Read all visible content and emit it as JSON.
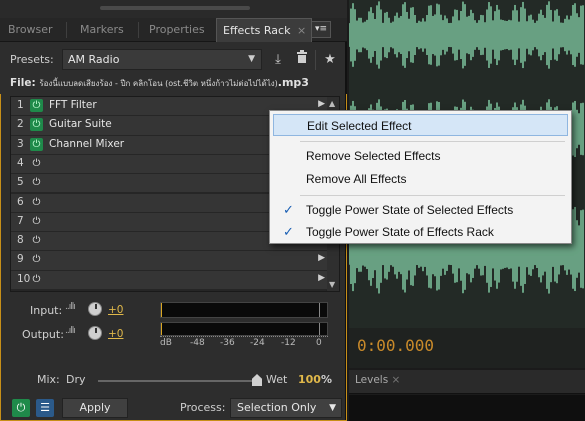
{
  "tabs": [
    "Browser",
    "Markers",
    "Properties",
    "Effects Rack"
  ],
  "tab_close": "×",
  "panel_menu_icon": "▾≡",
  "presets": {
    "label": "Presets:",
    "value": "AM Radio",
    "arrow": "▼"
  },
  "icons": {
    "save": "⤓",
    "delete": "🗑",
    "favorite": "★"
  },
  "file": {
    "prefix": "File:",
    "name": "ร้องนี้แบบลดเสียงร้อง - ปีก คลิกโอน (ost.ชีวิต หนึ่งก้าวไม่ต่อไปได้ไง)",
    "ext": ".mp3"
  },
  "slots": [
    {
      "num": "1",
      "name": "FFT Filter",
      "on": true,
      "play": "▶"
    },
    {
      "num": "2",
      "name": "Guitar Suite",
      "on": true,
      "play": ""
    },
    {
      "num": "3",
      "name": "Channel Mixer",
      "on": true,
      "play": ""
    },
    {
      "num": "4",
      "name": "",
      "on": false,
      "play": ""
    },
    {
      "num": "5",
      "name": "",
      "on": false,
      "play": ""
    },
    {
      "num": "6",
      "name": "",
      "on": false,
      "play": ""
    },
    {
      "num": "7",
      "name": "",
      "on": false,
      "play": ""
    },
    {
      "num": "8",
      "name": "",
      "on": false,
      "play": ""
    },
    {
      "num": "9",
      "name": "",
      "on": false,
      "play": "▶"
    },
    {
      "num": "10",
      "name": "",
      "on": false,
      "play": "▶"
    }
  ],
  "power_icon": "⏻",
  "scroll": {
    "up": "▲",
    "down": "▼"
  },
  "input": {
    "label": "Input:",
    "value": "+0"
  },
  "output": {
    "label": "Output:",
    "value": "+0"
  },
  "level_bars": "..ıllı",
  "meter_scale": [
    "dB",
    "-48",
    "-36",
    "-24",
    "-12",
    "0"
  ],
  "mix": {
    "label": "Mix:",
    "dry": "Dry",
    "wet": "Wet",
    "percent": "100",
    "unit": "%",
    "level_fraction": 1.0
  },
  "bottom": {
    "power": "⏻",
    "list": "☰",
    "apply": "Apply",
    "process_label": "Process:",
    "process_value": "Selection Only",
    "arrow": "▼"
  },
  "time": "0:00.000",
  "levels": {
    "label": "Levels",
    "close": "×"
  },
  "context_menu": {
    "items": [
      {
        "label": "Edit Selected Effect",
        "checked": false,
        "highlight": true
      },
      {
        "label": "Remove Selected Effects",
        "checked": false,
        "highlight": false
      },
      {
        "label": "Remove All Effects",
        "checked": false,
        "highlight": false
      },
      {
        "label": "Toggle Power State of Selected Effects",
        "checked": true,
        "highlight": false
      },
      {
        "label": "Toggle Power State of Effects Rack",
        "checked": true,
        "highlight": false
      }
    ],
    "check_glyph": "✓"
  },
  "colors": {
    "accent": "#e0b84a",
    "power_on": "#1f8a4a",
    "waveform": "#7fc8a0",
    "menu_highlight": "#d5e6f7"
  }
}
